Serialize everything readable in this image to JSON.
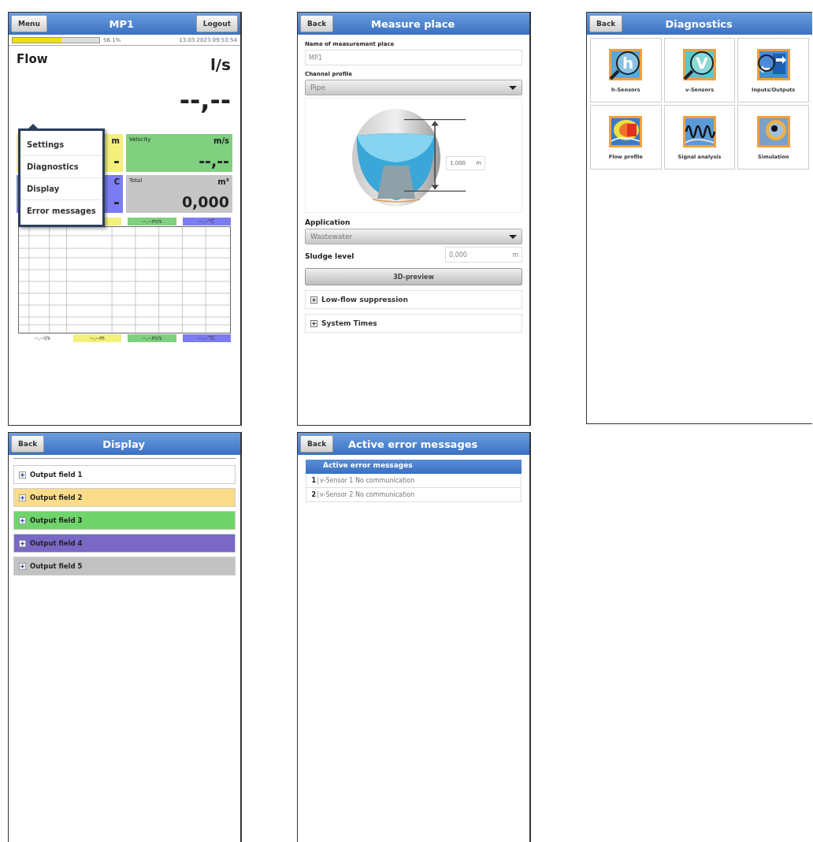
{
  "main_screen": {
    "left_button": "Menu",
    "title": "MP1",
    "right_button": "Logout",
    "progress": {
      "level": 0.561,
      "reading": "56.1%"
    },
    "timestamp": "13.03.2023 09:53:54",
    "measurement": {
      "label": "Flow",
      "unit": "l/s",
      "value": "--,--"
    },
    "tiles": [
      {
        "unit": "m",
        "value": "-",
        "color": "#f3f07c"
      },
      {
        "label": "Velocity",
        "unit": "m/s",
        "value": "--,--",
        "color": "#7fd07f"
      },
      {
        "unit": "C",
        "value": "-",
        "color": "#7c7cf2"
      },
      {
        "label": "Total",
        "unit": "m³",
        "value": "0,000",
        "color": "#c6c6c6"
      }
    ],
    "legend_top": [
      {
        "color": "#f3f07c"
      },
      {
        "text": "--,--m/s",
        "color": "#7fd07f"
      },
      {
        "text": "--,--°C",
        "color": "#7c7cf2"
      }
    ],
    "legend_bottom": [
      {
        "text": "--,--l/s",
        "color": "#ffffff"
      },
      {
        "text": "--,--m",
        "color": "#f3f07c"
      },
      {
        "text": "--,--m/s",
        "color": "#7fd07f"
      },
      {
        "text": "--,--°C",
        "color": "#7c7cf2"
      }
    ],
    "menu": {
      "items": [
        "Settings",
        "Diagnostics",
        "Display",
        "Error messages"
      ]
    }
  },
  "measure_place_screen": {
    "back_button": "Back",
    "title": "Measure place",
    "name_field": {
      "label": "Name of measurement place",
      "value": "MP1"
    },
    "channel_profile": {
      "label": "Channel profile",
      "value": "Pipe"
    },
    "diameter": {
      "value": "1,000",
      "unit": "m"
    },
    "application": {
      "label": "Application",
      "value": "Wastewater"
    },
    "sludge_level": {
      "label": "Sludge level",
      "value": "0,000",
      "unit": "m"
    },
    "preview_button": "3D-preview",
    "sections": [
      {
        "label": "Low-flow suppression",
        "expanded": false
      },
      {
        "label": "System Times",
        "expanded": false
      }
    ]
  },
  "diagnostics_screen": {
    "back_button": "Back",
    "title": "Diagnostics",
    "tiles": [
      {
        "kind": "h",
        "glyph": "h",
        "label": "h-Sensors"
      },
      {
        "kind": "v",
        "glyph": "V",
        "label": "v-Sensors"
      },
      {
        "kind": "io",
        "label": "Inputs/Outputs"
      },
      {
        "kind": "flow",
        "label": "Flow profile"
      },
      {
        "kind": "signal",
        "label": "Signal analysis"
      },
      {
        "kind": "simulation",
        "label": "Simulation"
      }
    ]
  },
  "display_screen": {
    "back_button": "Back",
    "title": "Display",
    "fields": [
      {
        "label": "Output field 1",
        "color": "#ffffff",
        "expanded": false
      },
      {
        "label": "Output field 2",
        "color": "#fbdc8a",
        "expanded": false
      },
      {
        "label": "Output field 3",
        "color": "#70d46c",
        "expanded": false
      },
      {
        "label": "Output field 4",
        "color": "#7a68c6",
        "expanded": false
      },
      {
        "label": "Output field 5",
        "color": "#c2c2c2",
        "expanded": false
      }
    ]
  },
  "error_screen": {
    "back_button": "Back",
    "title": "Active error messages",
    "table": {
      "header": "Active error messages",
      "rows": [
        {
          "index": "1",
          "message": "v-Sensor 1 No communication"
        },
        {
          "index": "2",
          "message": "v-Sensor 2 No communication"
        }
      ]
    }
  }
}
